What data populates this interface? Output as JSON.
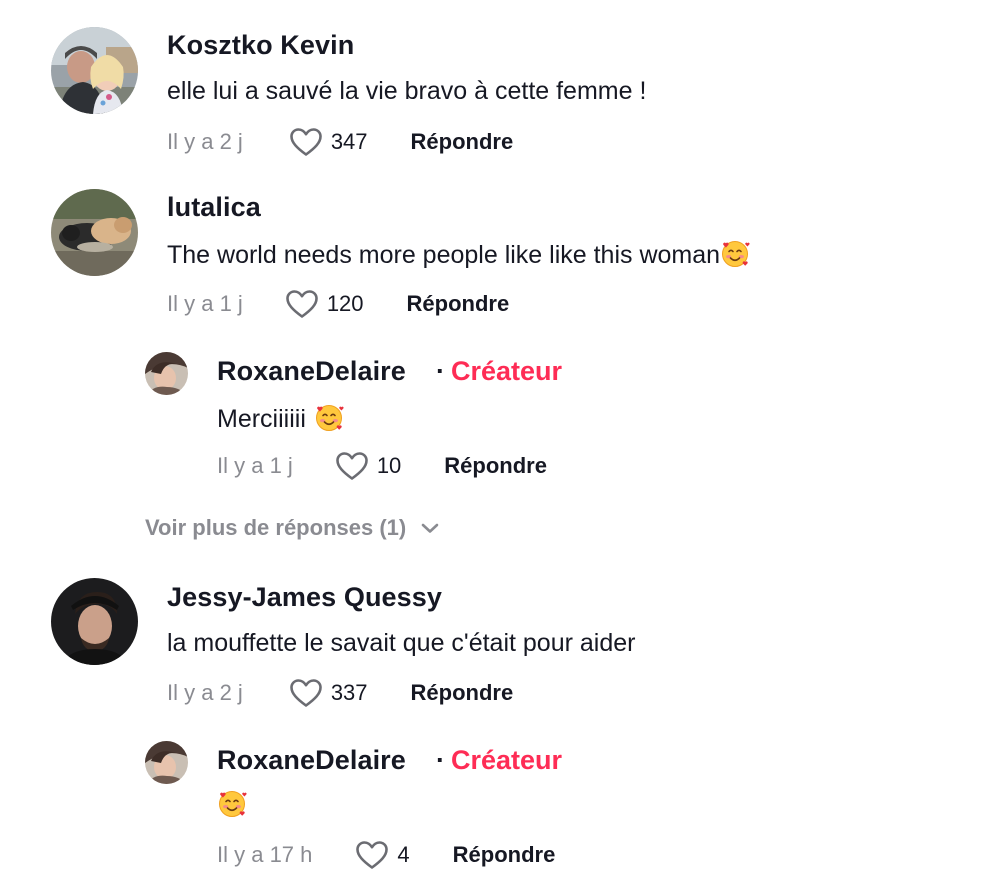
{
  "comments": [
    {
      "username": "Kosztko Kevin",
      "text": "elle lui a sauvé la vie bravo à cette femme !",
      "time": "Il y a 2 j",
      "likes": "347",
      "reply_label": "Répondre"
    },
    {
      "username": "lutalica",
      "text": "The world needs more people like like this woman",
      "time": "Il y a 1 j",
      "likes": "120",
      "reply_label": "Répondre",
      "reply": {
        "username": "RoxaneDelaire",
        "separator": "·",
        "badge": "Créateur",
        "text": "Merciiiiii",
        "time": "Il y a 1 j",
        "likes": "10",
        "reply_label": "Répondre"
      },
      "more_replies": "Voir plus de réponses (1)"
    },
    {
      "username": "Jessy-James Quessy",
      "text": "la mouffette le savait que c'était pour aider",
      "time": "Il y a 2 j",
      "likes": "337",
      "reply_label": "Répondre",
      "reply": {
        "username": "RoxaneDelaire",
        "separator": "·",
        "badge": "Créateur",
        "text": "",
        "time": "Il y a 17 h",
        "likes": "4",
        "reply_label": "Répondre"
      }
    }
  ],
  "colors": {
    "creator": "#fe2c55",
    "muted": "#8a8b91",
    "text": "#161823"
  },
  "icons": {
    "like": "heart-outline-icon",
    "expand": "chevron-down-icon",
    "emoji": "smiling-face-with-hearts"
  }
}
